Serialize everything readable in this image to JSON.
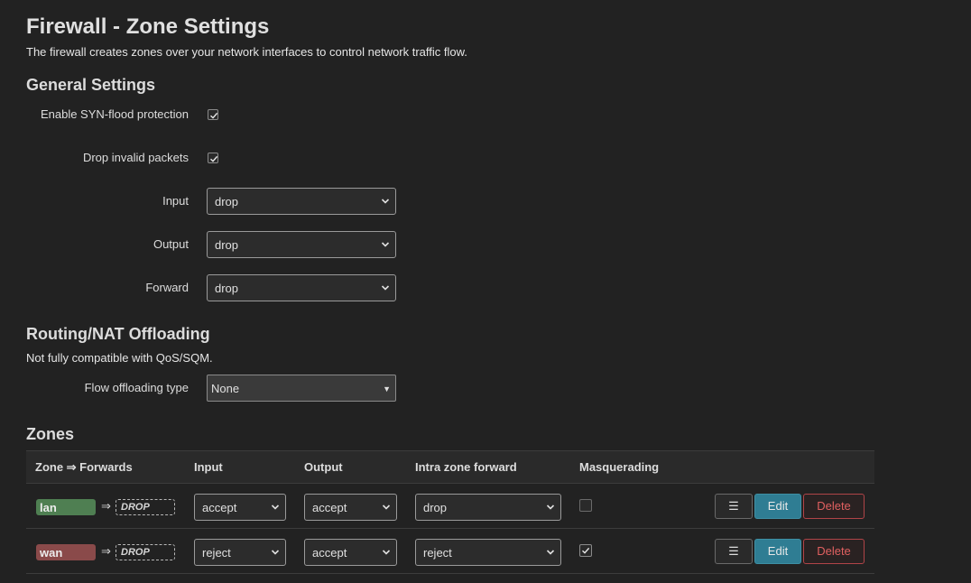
{
  "page": {
    "title": "Firewall - Zone Settings",
    "description": "The firewall creates zones over your network interfaces to control network traffic flow."
  },
  "general": {
    "heading": "General Settings",
    "syn_flood": {
      "label": "Enable SYN-flood protection",
      "checked": true
    },
    "drop_invalid": {
      "label": "Drop invalid packets",
      "checked": true
    },
    "input": {
      "label": "Input",
      "value": "drop"
    },
    "output": {
      "label": "Output",
      "value": "drop"
    },
    "forward": {
      "label": "Forward",
      "value": "drop"
    }
  },
  "offloading": {
    "heading": "Routing/NAT Offloading",
    "note": "Not fully compatible with QoS/SQM.",
    "type_label": "Flow offloading type",
    "type_value": "None"
  },
  "zones": {
    "heading": "Zones",
    "columns": {
      "zone": "Zone ⇒ Forwards",
      "input": "Input",
      "output": "Output",
      "intra": "Intra zone forward",
      "masq": "Masquerading"
    },
    "rows": [
      {
        "name": "lan",
        "color": "#4f7f52",
        "arrow": "⇒",
        "forward": "DROP",
        "input": "accept",
        "output": "accept",
        "intra": "drop",
        "masq": false
      },
      {
        "name": "wan",
        "color": "#8a4a4a",
        "arrow": "⇒",
        "forward": "DROP",
        "input": "reject",
        "output": "accept",
        "intra": "reject",
        "masq": true
      }
    ],
    "actions": {
      "menu": "☰",
      "edit": "Edit",
      "delete": "Delete"
    }
  }
}
